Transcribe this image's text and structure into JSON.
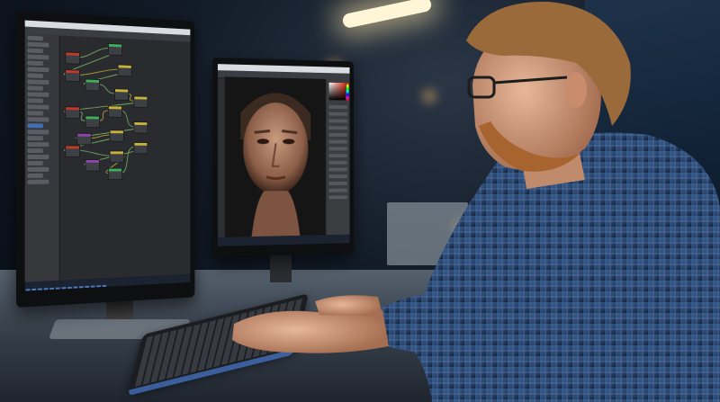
{
  "scene": {
    "description_hint": "",
    "left_monitor": {
      "window_title": "",
      "outliner_rows": 24,
      "nodes": [
        {
          "color": "#c0392b"
        },
        {
          "color": "#3fae5a"
        },
        {
          "color": "#c0392b"
        },
        {
          "color": "#c8b23a"
        },
        {
          "color": "#3fae5a"
        },
        {
          "color": "#c8b23a"
        },
        {
          "color": "#c8b23a"
        },
        {
          "color": "#c0392b"
        },
        {
          "color": "#3fae5a"
        },
        {
          "color": "#c8b23a"
        },
        {
          "color": "#c8b23a"
        },
        {
          "color": "#8e44ad"
        },
        {
          "color": "#c8b23a"
        },
        {
          "color": "#c0392b"
        },
        {
          "color": "#c8b23a"
        },
        {
          "color": "#3fae5a"
        },
        {
          "color": "#c8b23a"
        },
        {
          "color": "#8e44ad"
        }
      ],
      "taskbar_icons": 14
    },
    "right_monitor": {
      "viewport_subject": "face-render"
    },
    "colors": {
      "accent_blue": "#3f6fb4",
      "shirt": "#2f4f7a",
      "hair": "#9a6a3a",
      "keyboard_glow": "#4a7ad0"
    }
  }
}
